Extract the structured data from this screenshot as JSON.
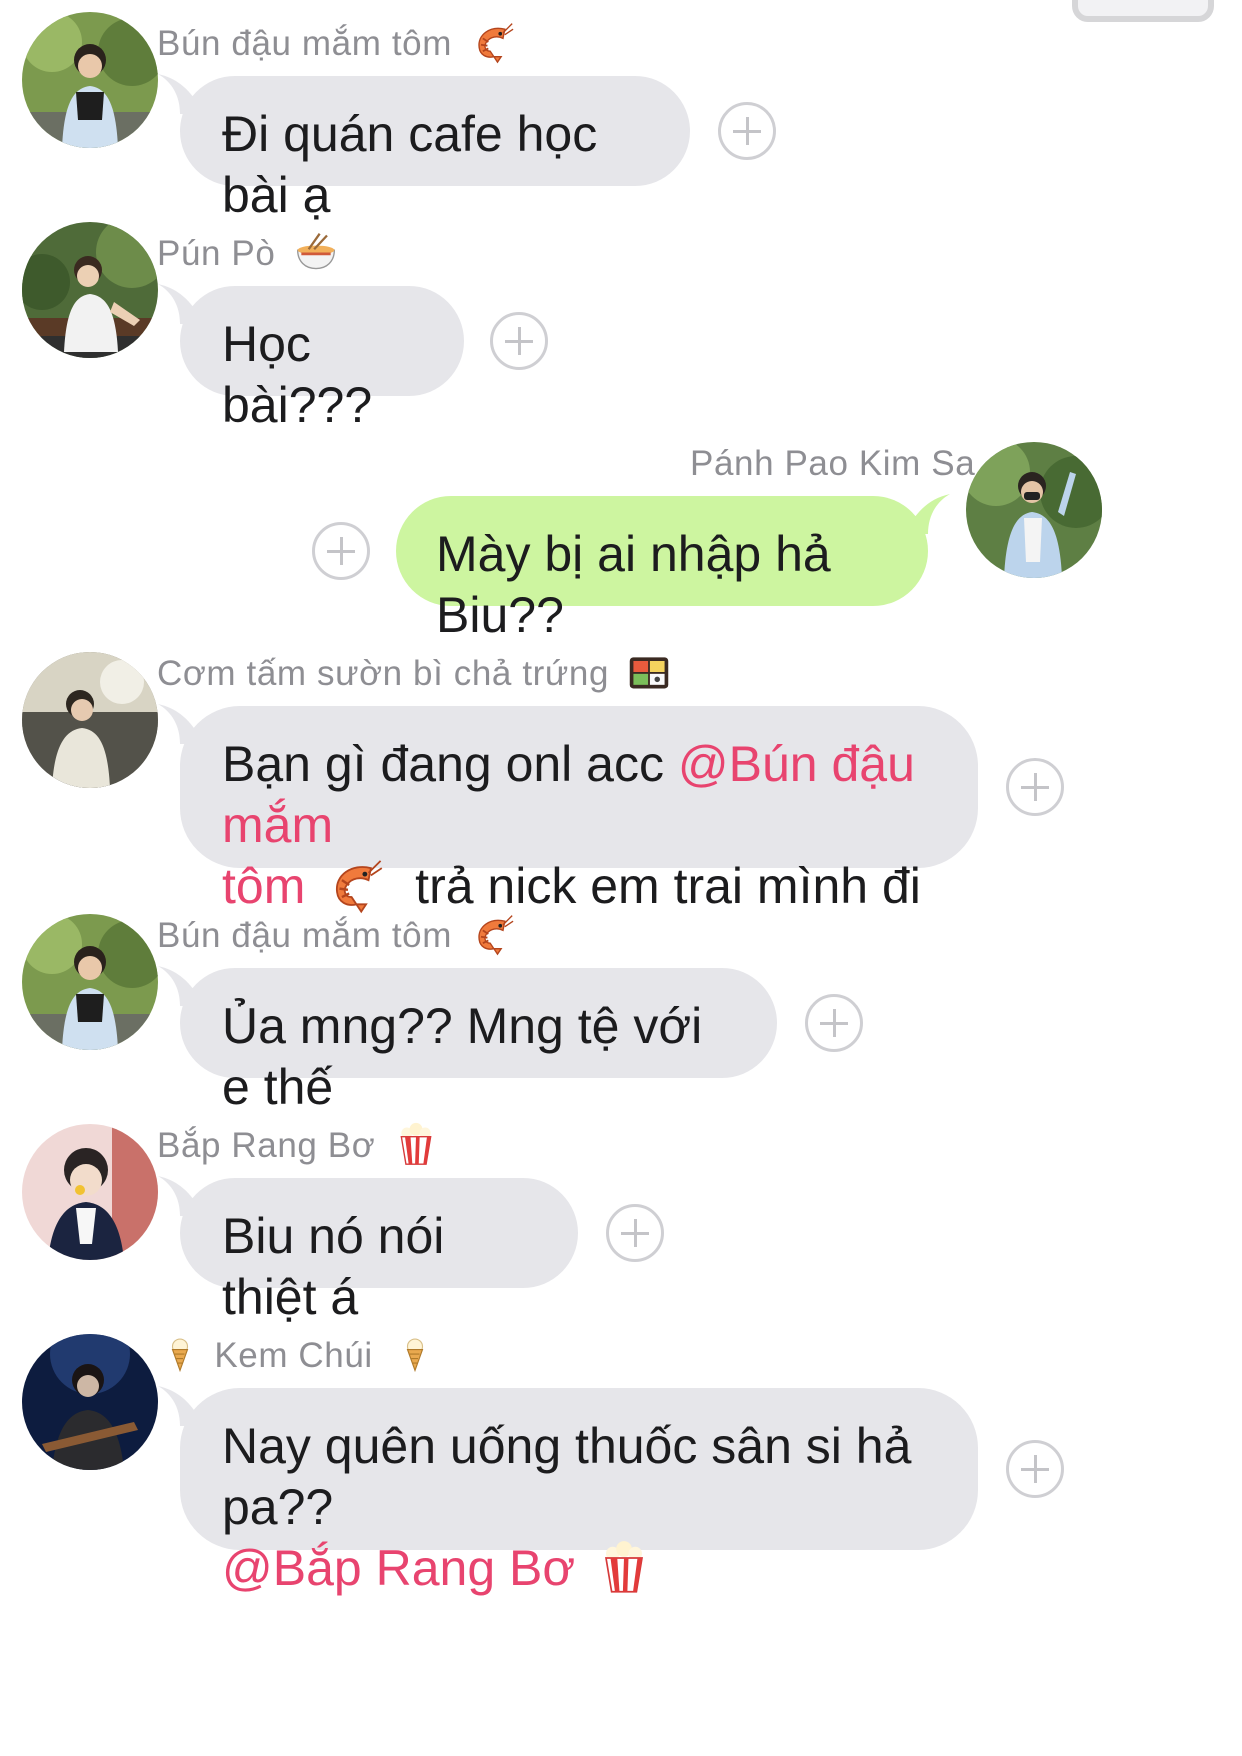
{
  "messages": [
    {
      "sender": "Bún đậu mắm tôm",
      "sender_emoji": "shrimp-icon",
      "text": "Đi quán cafe học bài ạ",
      "direction": "incoming"
    },
    {
      "sender": "Pún Pò",
      "sender_emoji": "noodle-bowl-icon",
      "text": "Học bài???",
      "direction": "incoming"
    },
    {
      "sender": "Pánh Pao Kim Sa",
      "text": "Mày bị ai nhập hả Biu??",
      "direction": "outgoing"
    },
    {
      "sender": "Cơm tấm sườn bì chả trứng",
      "sender_emoji": "bento-box-icon",
      "text_before": "Bạn gì đang onl acc ",
      "mention_line1": "@Bún đậu mắm",
      "mention_line2": "tôm",
      "mention_emoji": "shrimp-icon",
      "text_after": "trả nick em trai mình đi",
      "direction": "incoming"
    },
    {
      "sender": "Bún đậu mắm tôm",
      "sender_emoji": "shrimp-icon",
      "text": "Ủa mng?? Mng tệ với e thế",
      "direction": "incoming"
    },
    {
      "sender": "Bắp Rang Bơ",
      "sender_emoji": "popcorn-icon",
      "text": "Biu nó nói thiệt á",
      "direction": "incoming"
    },
    {
      "sender": "Kem Chúi",
      "sender_emoji": "ice-cream-icon",
      "text_line1": "Nay quên uống thuốc sân si hả pa??",
      "mention": "@Bắp Rang Bơ",
      "mention_emoji": "popcorn-icon",
      "direction": "incoming"
    }
  ],
  "colors": {
    "incoming_bubble": "#e6e6ea",
    "outgoing_bubble": "#cdf5a0",
    "mention": "#e8446f",
    "sender_name": "#8e8e93"
  }
}
